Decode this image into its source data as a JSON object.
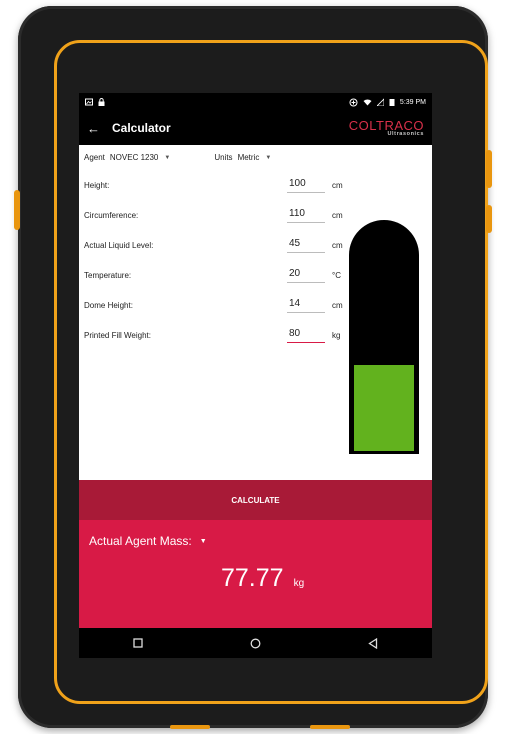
{
  "status": {
    "time": "5:39 PM"
  },
  "app_bar": {
    "title": "Calculator",
    "brand_name": "COLTRACO",
    "brand_sub": "Ultrasonics"
  },
  "selectors": {
    "agent": {
      "label": "Agent",
      "value": "NOVEC 1230"
    },
    "units": {
      "label": "Units",
      "value": "Metric"
    }
  },
  "fields": [
    {
      "label": "Height:",
      "value": "100",
      "unit": "cm"
    },
    {
      "label": "Circumference:",
      "value": "110",
      "unit": "cm"
    },
    {
      "label": "Actual Liquid Level:",
      "value": "45",
      "unit": "cm"
    },
    {
      "label": "Temperature:",
      "value": "20",
      "unit": "°C"
    },
    {
      "label": "Dome Height:",
      "value": "14",
      "unit": "cm"
    },
    {
      "label": "Printed Fill Weight:",
      "value": "80",
      "unit": "kg"
    }
  ],
  "tank": {
    "fill_fraction": 0.37,
    "fill_color": "#62b21e"
  },
  "calculate_label": "CALCULATE",
  "result": {
    "label": "Actual Agent Mass:",
    "value": "77.77",
    "unit": "kg"
  },
  "colors": {
    "accent": "#d81a46",
    "button": "#a81a37",
    "bumper": "#f0a21a"
  }
}
